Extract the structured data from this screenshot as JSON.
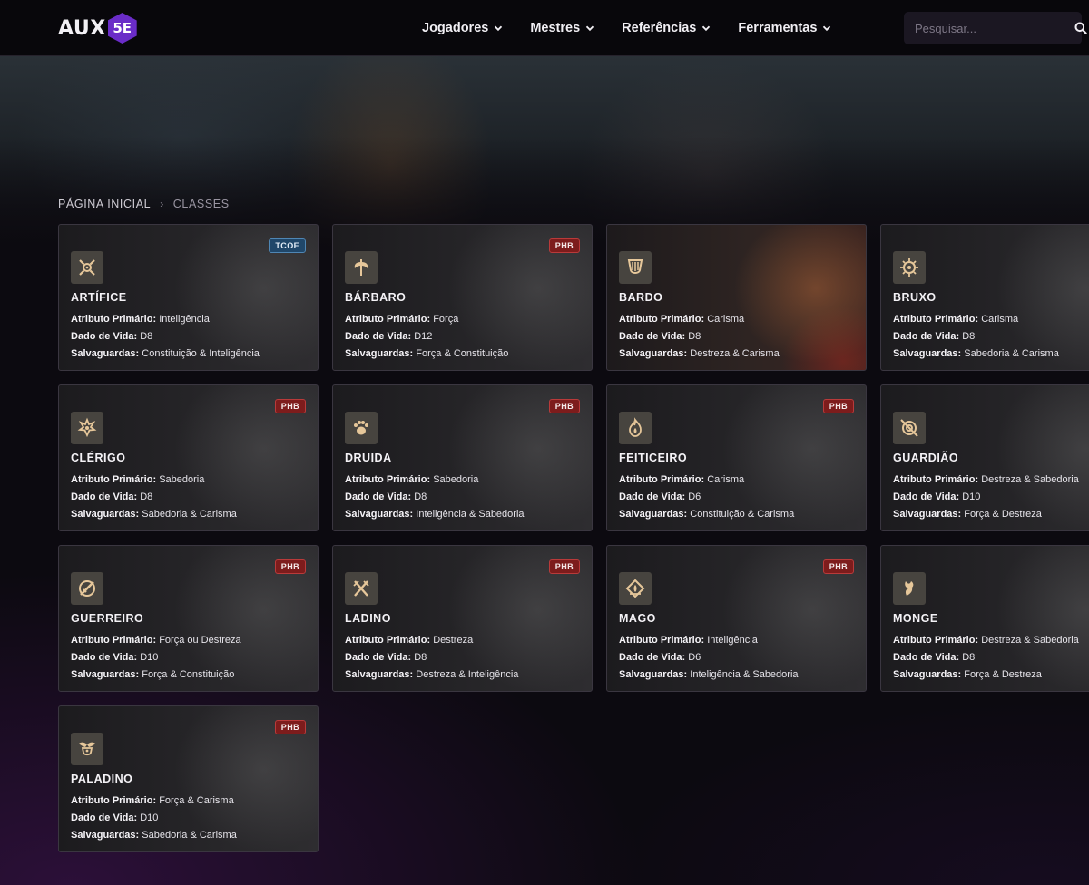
{
  "brand": {
    "text": "AUX",
    "badge": "5E"
  },
  "nav": [
    {
      "label": "Jogadores"
    },
    {
      "label": "Mestres"
    },
    {
      "label": "Referências"
    },
    {
      "label": "Ferramentas"
    }
  ],
  "search": {
    "placeholder": "Pesquisar..."
  },
  "breadcrumb": {
    "home": "Página Inicial",
    "separator": "›",
    "current": "Classes"
  },
  "labels": {
    "primary": "Atributo Primário:",
    "hit_die": "Dado de Vida:",
    "saves": "Salvaguardas:"
  },
  "classes": [
    {
      "name": "Artífice",
      "source": "TCOE",
      "icon": "artificer-icon",
      "primary": "Inteligência",
      "hit_die": "D8",
      "saves": "Constituição & Inteligência"
    },
    {
      "name": "Bárbaro",
      "source": "PHB",
      "icon": "barbarian-icon",
      "primary": "Força",
      "hit_die": "D12",
      "saves": "Força & Constituição"
    },
    {
      "name": "Bardo",
      "source": "",
      "icon": "bard-icon",
      "primary": "Carisma",
      "hit_die": "D8",
      "saves": "Destreza & Carisma"
    },
    {
      "name": "Bruxo",
      "source": "",
      "icon": "warlock-icon",
      "primary": "Carisma",
      "hit_die": "D8",
      "saves": "Sabedoria & Carisma"
    },
    {
      "name": "Clérigo",
      "source": "PHB",
      "icon": "cleric-icon",
      "primary": "Sabedoria",
      "hit_die": "D8",
      "saves": "Sabedoria & Carisma"
    },
    {
      "name": "Druida",
      "source": "PHB",
      "icon": "druid-icon",
      "primary": "Sabedoria",
      "hit_die": "D8",
      "saves": "Inteligência & Sabedoria"
    },
    {
      "name": "Feiticeiro",
      "source": "PHB",
      "icon": "sorcerer-icon",
      "primary": "Carisma",
      "hit_die": "D6",
      "saves": "Constituição & Carisma"
    },
    {
      "name": "Guardião",
      "source": "",
      "icon": "ranger-icon",
      "primary": "Destreza & Sabedoria",
      "hit_die": "D10",
      "saves": "Força & Destreza"
    },
    {
      "name": "Guerreiro",
      "source": "PHB",
      "icon": "fighter-icon",
      "primary": "Força ou Destreza",
      "hit_die": "D10",
      "saves": "Força & Constituição"
    },
    {
      "name": "Ladino",
      "source": "PHB",
      "icon": "rogue-icon",
      "primary": "Destreza",
      "hit_die": "D8",
      "saves": "Destreza & Inteligência"
    },
    {
      "name": "Mago",
      "source": "PHB",
      "icon": "wizard-icon",
      "primary": "Inteligência",
      "hit_die": "D6",
      "saves": "Inteligência & Sabedoria"
    },
    {
      "name": "Monge",
      "source": "",
      "icon": "monk-icon",
      "primary": "Destreza & Sabedoria",
      "hit_die": "D8",
      "saves": "Força & Destreza"
    },
    {
      "name": "Paladino",
      "source": "PHB",
      "icon": "paladin-icon",
      "primary": "Força & Carisma",
      "hit_die": "D10",
      "saves": "Sabedoria & Carisma"
    }
  ],
  "colors": {
    "accent": "#6a2cc8",
    "phb_badge": "#7d1c1c",
    "tcoe_badge": "#20476a",
    "icon_gold": "#e6c79a"
  }
}
